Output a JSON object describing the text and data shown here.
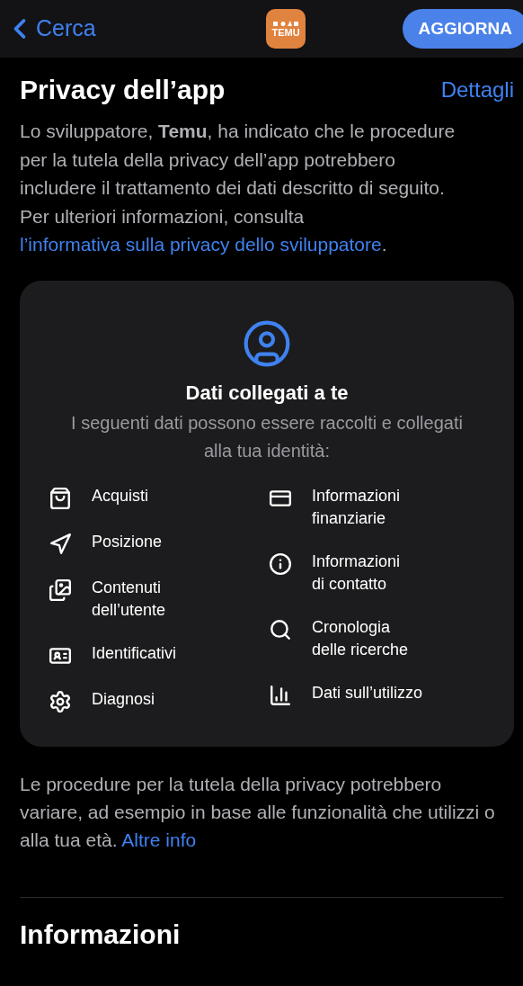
{
  "nav": {
    "back": "Cerca",
    "app_icon": "TEMU",
    "button": "AGGIORNA"
  },
  "section": {
    "title": "Privacy dell’app",
    "link": "Dettagli"
  },
  "intro": {
    "text": "Lo sviluppatore, **Temu**, ha indicato che le procedure per la tutela della privacy dell’app potrebbero includere il trattamento dei dati descritto di seguito. Per ulteriori informazioni, consulta",
    "link_lines": [
      "l’informativa sulla privacy dello",
      "sviluppatore"
    ],
    "end": "."
  },
  "card": {
    "title": "Dati collegati a te",
    "subtitle": "I seguenti dati possono essere raccolti e collegati alla tua identità:",
    "columns": [
      [
        {
          "kind": "bag",
          "label": "Acquisti"
        },
        {
          "kind": "location",
          "label": "Posizione"
        },
        {
          "kind": "photos",
          "label": "Contenuti\ndell’utente"
        },
        {
          "kind": "id",
          "label": "Identificativi"
        },
        {
          "kind": "gear",
          "label": "Diagnosi"
        }
      ],
      [
        {
          "kind": "card",
          "label": "Informazioni\nfinanziarie"
        },
        {
          "kind": "info",
          "label": "Informazioni\ndi contatto"
        },
        {
          "kind": "search",
          "label": "Cronologia\ndelle ricerche"
        },
        {
          "kind": "chart",
          "label": "Dati sull’utilizzo"
        }
      ]
    ]
  },
  "note": {
    "text": "Le procedure per la tutela della privacy potrebbero variare, ad esempio in base alle funzionalità che utilizzi o alla tua età.",
    "link": "Altre info"
  },
  "next_section": {
    "title": "Informazioni"
  }
}
